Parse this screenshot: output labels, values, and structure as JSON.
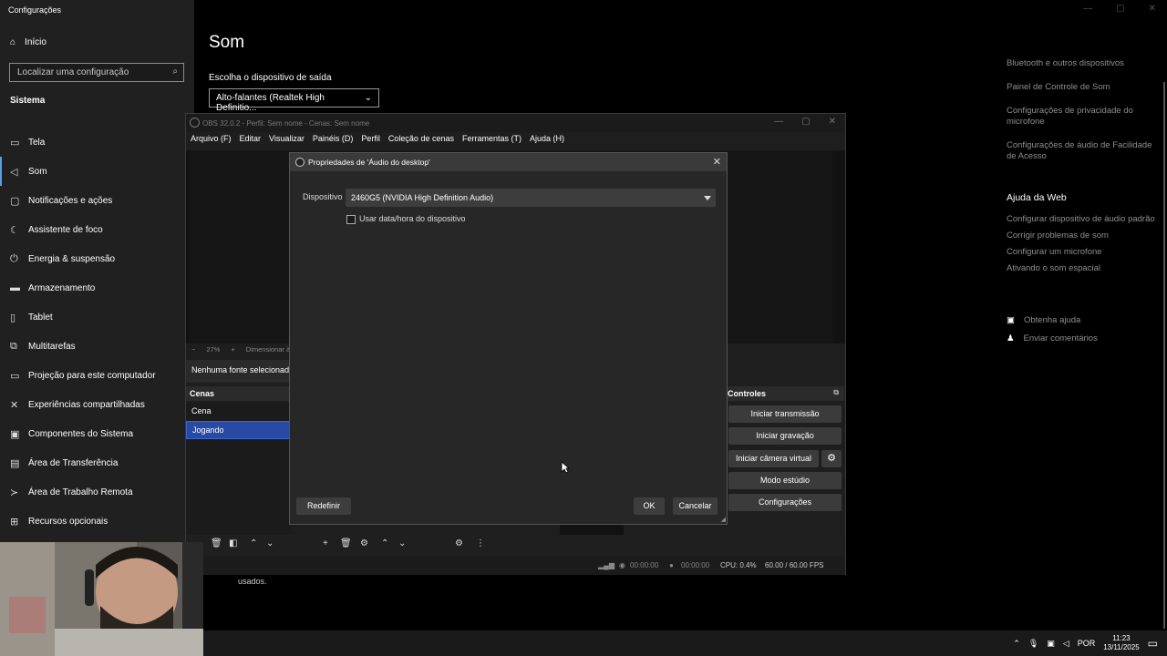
{
  "settings": {
    "window_title": "Configurações",
    "home_label": "Início",
    "search_placeholder": "Localizar uma configuração",
    "section": "Sistema",
    "nav_items": [
      {
        "label": "Tela",
        "icon": "monitor-icon"
      },
      {
        "label": "Som",
        "icon": "speaker-icon",
        "active": true
      },
      {
        "label": "Notificações e ações",
        "icon": "notification-icon"
      },
      {
        "label": "Assistente de foco",
        "icon": "moon-icon"
      },
      {
        "label": "Energia & suspensão",
        "icon": "power-icon"
      },
      {
        "label": "Armazenamento",
        "icon": "storage-icon"
      },
      {
        "label": "Tablet",
        "icon": "tablet-icon"
      },
      {
        "label": "Multitarefas",
        "icon": "multitask-icon"
      },
      {
        "label": "Projeção para este computador",
        "icon": "projection-icon"
      },
      {
        "label": "Experiências compartilhadas",
        "icon": "share-icon"
      },
      {
        "label": "Componentes do Sistema",
        "icon": "components-icon"
      },
      {
        "label": "Área de Transferência",
        "icon": "clipboard-icon"
      },
      {
        "label": "Área de Trabalho Remota",
        "icon": "remote-icon"
      },
      {
        "label": "Recursos opcionais",
        "icon": "features-icon"
      }
    ],
    "page_title": "Som",
    "output_label": "Escolha o dispositivo de saída",
    "output_value": "Alto-falantes (Realtek High Definitio...",
    "related_links": [
      "Bluetooth e outros dispositivos",
      "Painel de Controle de Som",
      "Configurações de privacidade do microfone",
      "Configurações de áudio de Facilidade de Acesso"
    ],
    "help_title": "Ajuda da Web",
    "help_links": [
      "Configurar dispositivo de áudio padrão",
      "Corrigir problemas de som",
      "Configurar um microfone",
      "Ativando o som espacial"
    ],
    "get_help": "Obtenha ajuda",
    "feedback": "Enviar comentários",
    "partial_text": "usados."
  },
  "obs": {
    "title": "OBS 32.0.2 - Perfil: Sem nome - Cenas: Sem nome",
    "menu": [
      "Arquivo (F)",
      "Editar",
      "Visualizar",
      "Painéis (D)",
      "Perfil",
      "Coleção de cenas",
      "Ferramentas (T)",
      "Ajuda (H)"
    ],
    "zoom_minus": "−",
    "zoom": "27%",
    "zoom_plus": "+",
    "zoom_mode": "Dimensionar à",
    "no_source": "Nenhuma fonte selecionada",
    "scenes_header": "Cenas",
    "scenes": [
      "Cena",
      "Jogando"
    ],
    "controls_header": "Controles",
    "controls": [
      "Iniciar transmissão",
      "Iniciar gravação",
      "Iniciar câmera virtual",
      "Modo estúdio",
      "Configurações"
    ],
    "status": {
      "time1": "00:00:00",
      "time2": "00:00:00",
      "cpu": "CPU: 0.4%",
      "fps": "60.00 / 60.00 FPS"
    }
  },
  "dialog": {
    "title": "Propriedades de 'Áudio do desktop'",
    "device_label": "Dispositivo",
    "device_value": "2460G5 (NVIDIA High Definition Audio)",
    "checkbox_label": "Usar data/hora do dispositivo",
    "checkbox_checked": false,
    "reset": "Redefinir",
    "ok": "OK",
    "cancel": "Cancelar"
  },
  "taskbar": {
    "lang": "POR",
    "time": "11:23",
    "date": "13/11/2025"
  }
}
